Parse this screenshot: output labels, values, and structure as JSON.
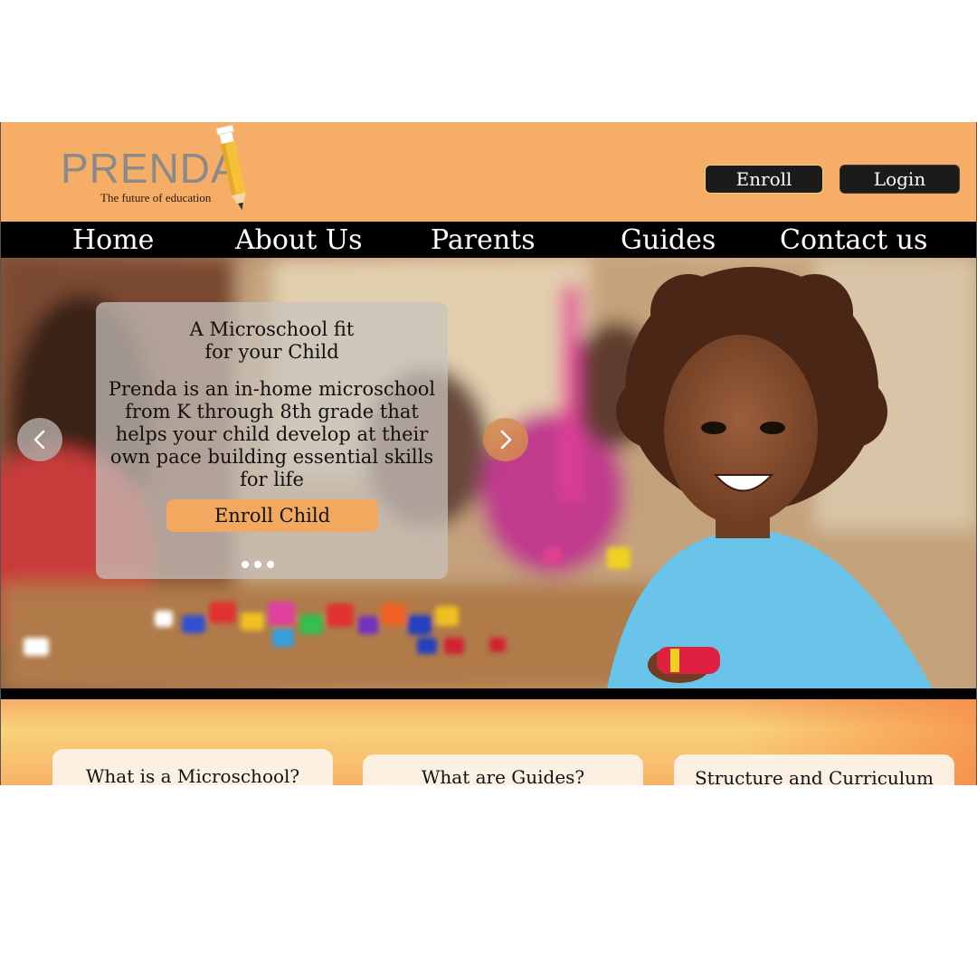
{
  "brand": {
    "name": "PRENDA",
    "tagline": "The future of education"
  },
  "header": {
    "enroll_label": "Enroll",
    "login_label": "Login"
  },
  "nav": {
    "items": [
      {
        "label": "Home"
      },
      {
        "label": "About Us"
      },
      {
        "label": "Parents"
      },
      {
        "label": "Guides"
      },
      {
        "label": "Contact us"
      }
    ]
  },
  "hero": {
    "title": "A Microschool fit for your Child",
    "body": "Prenda is an in-home microschool from K through 8th grade that helps your child develop at their own pace building essential skills for life",
    "cta_label": "Enroll Child",
    "prev_icon": "chevron-left-icon",
    "next_icon": "chevron-right-icon",
    "slide_count": 3
  },
  "features": [
    {
      "title": "What is a Microschool?"
    },
    {
      "title": "What are Guides?"
    },
    {
      "title": "Structure and Curriculum"
    }
  ],
  "colors": {
    "header_bg": "#f6ad68",
    "nav_bg": "#000000",
    "button_dark": "#1d1b1a",
    "cta": "#f2a95f",
    "card_bg": "#fcf0e2"
  }
}
